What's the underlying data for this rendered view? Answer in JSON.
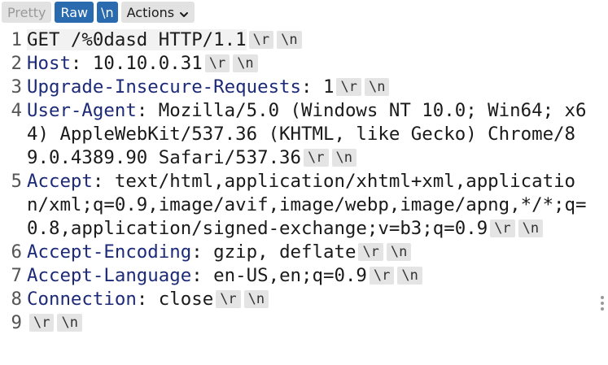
{
  "toolbar": {
    "pretty_label": "Pretty",
    "raw_label": "Raw",
    "newline_label": "\\n",
    "actions_label": "Actions",
    "active_tab": "Raw"
  },
  "crlf": {
    "cr": "\\r",
    "lf": "\\n"
  },
  "request_lines": [
    {
      "number": "1",
      "name": "",
      "sep": "",
      "value": "GET /%0dasd HTTP/1.1"
    },
    {
      "number": "2",
      "name": "Host",
      "sep": ":",
      "value": " 10.10.0.31"
    },
    {
      "number": "3",
      "name": "Upgrade-Insecure-Requests",
      "sep": ":",
      "value": " 1"
    },
    {
      "number": "4",
      "name": "User-Agent",
      "sep": ":",
      "value": " Mozilla/5.0 (Windows NT 10.0; Win64; x64) AppleWebKit/537.36 (KHTML, like Gecko) Chrome/89.0.4389.90 Safari/537.36"
    },
    {
      "number": "5",
      "name": "Accept",
      "sep": ":",
      "value": " text/html,application/xhtml+xml,application/xml;q=0.9,image/avif,image/webp,image/apng,*/*;q=0.8,application/signed-exchange;v=b3;q=0.9"
    },
    {
      "number": "6",
      "name": "Accept-Encoding",
      "sep": ":",
      "value": " gzip, deflate"
    },
    {
      "number": "7",
      "name": "Accept-Language",
      "sep": ":",
      "value": " en-US,en;q=0.9"
    },
    {
      "number": "8",
      "name": "Connection",
      "sep": ":",
      "value": " close"
    },
    {
      "number": "9",
      "name": "",
      "sep": "",
      "value": ""
    }
  ],
  "colors": {
    "active_tab": "#2a6bb0",
    "header_name": "#1c2a78",
    "crlf_badge_bg": "#e4e4e4"
  }
}
